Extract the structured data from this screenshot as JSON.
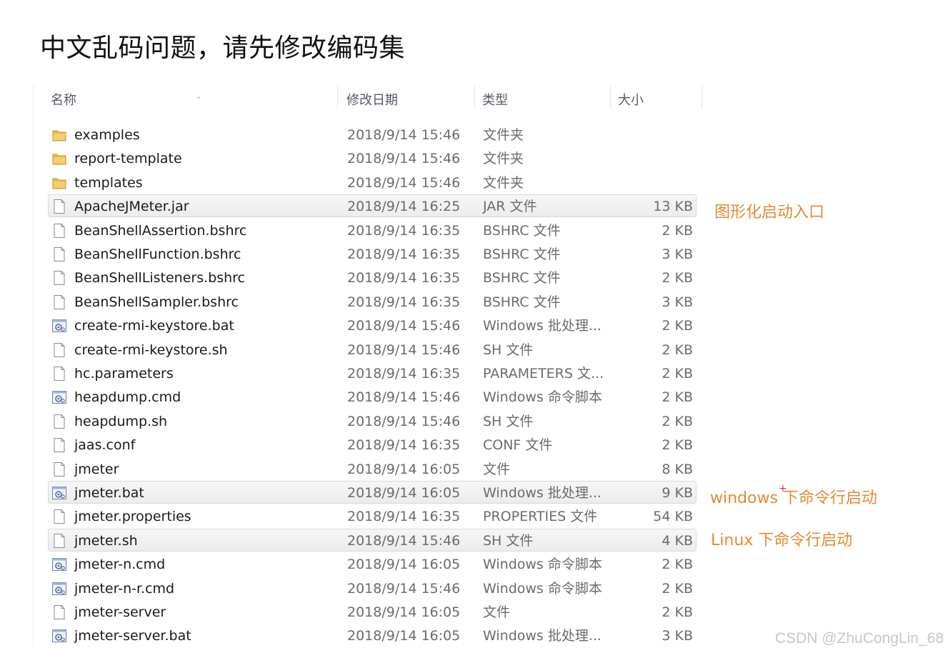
{
  "page_title": "中文乱码问题，请先修改编码集",
  "columns": {
    "name": "名称",
    "date": "修改日期",
    "type": "类型",
    "size": "大小"
  },
  "colors": {
    "annotation": "#e58a35",
    "folder": "#e8b84a"
  },
  "files": [
    {
      "name": "examples",
      "date": "2018/9/14 15:46",
      "type": "文件夹",
      "size": "",
      "icon": "folder-icon"
    },
    {
      "name": "report-template",
      "date": "2018/9/14 15:46",
      "type": "文件夹",
      "size": "",
      "icon": "folder-icon"
    },
    {
      "name": "templates",
      "date": "2018/9/14 15:46",
      "type": "文件夹",
      "size": "",
      "icon": "folder-icon"
    },
    {
      "name": "ApacheJMeter.jar",
      "date": "2018/9/14 16:25",
      "type": "JAR 文件",
      "size": "13 KB",
      "icon": "file-icon",
      "highlighted": true
    },
    {
      "name": "BeanShellAssertion.bshrc",
      "date": "2018/9/14 16:35",
      "type": "BSHRC 文件",
      "size": "2 KB",
      "icon": "file-icon"
    },
    {
      "name": "BeanShellFunction.bshrc",
      "date": "2018/9/14 16:35",
      "type": "BSHRC 文件",
      "size": "3 KB",
      "icon": "file-icon"
    },
    {
      "name": "BeanShellListeners.bshrc",
      "date": "2018/9/14 16:35",
      "type": "BSHRC 文件",
      "size": "2 KB",
      "icon": "file-icon"
    },
    {
      "name": "BeanShellSampler.bshrc",
      "date": "2018/9/14 16:35",
      "type": "BSHRC 文件",
      "size": "3 KB",
      "icon": "file-icon"
    },
    {
      "name": "create-rmi-keystore.bat",
      "date": "2018/9/14 15:46",
      "type": "Windows 批处理...",
      "size": "2 KB",
      "icon": "script-icon"
    },
    {
      "name": "create-rmi-keystore.sh",
      "date": "2018/9/14 15:46",
      "type": "SH 文件",
      "size": "2 KB",
      "icon": "file-icon"
    },
    {
      "name": "hc.parameters",
      "date": "2018/9/14 16:35",
      "type": "PARAMETERS 文...",
      "size": "2 KB",
      "icon": "file-icon"
    },
    {
      "name": "heapdump.cmd",
      "date": "2018/9/14 15:46",
      "type": "Windows 命令脚本",
      "size": "2 KB",
      "icon": "script-icon"
    },
    {
      "name": "heapdump.sh",
      "date": "2018/9/14 15:46",
      "type": "SH 文件",
      "size": "2 KB",
      "icon": "file-icon"
    },
    {
      "name": "jaas.conf",
      "date": "2018/9/14 16:35",
      "type": "CONF 文件",
      "size": "2 KB",
      "icon": "file-icon"
    },
    {
      "name": "jmeter",
      "date": "2018/9/14 16:05",
      "type": "文件",
      "size": "8 KB",
      "icon": "file-icon"
    },
    {
      "name": "jmeter.bat",
      "date": "2018/9/14 16:05",
      "type": "Windows 批处理...",
      "size": "9 KB",
      "icon": "script-icon",
      "highlighted": true
    },
    {
      "name": "jmeter.properties",
      "date": "2018/9/14 16:35",
      "type": "PROPERTIES 文件",
      "size": "54 KB",
      "icon": "file-icon"
    },
    {
      "name": "jmeter.sh",
      "date": "2018/9/14 15:46",
      "type": "SH 文件",
      "size": "4 KB",
      "icon": "file-icon",
      "highlighted": true
    },
    {
      "name": "jmeter-n.cmd",
      "date": "2018/9/14 16:05",
      "type": "Windows 命令脚本",
      "size": "2 KB",
      "icon": "script-icon"
    },
    {
      "name": "jmeter-n-r.cmd",
      "date": "2018/9/14 15:46",
      "type": "Windows 命令脚本",
      "size": "2 KB",
      "icon": "script-icon"
    },
    {
      "name": "jmeter-server",
      "date": "2018/9/14 16:05",
      "type": "文件",
      "size": "2 KB",
      "icon": "file-icon"
    },
    {
      "name": "jmeter-server.bat",
      "date": "2018/9/14 16:05",
      "type": "Windows 批处理...",
      "size": "3 KB",
      "icon": "script-icon"
    }
  ],
  "annotations": {
    "gui_launch": "图形化启动入口",
    "windows_cli": "windows 下命令行启动",
    "linux_cli": "Linux 下命令行启动"
  },
  "watermark": "CSDN @ZhuCongLin_68"
}
